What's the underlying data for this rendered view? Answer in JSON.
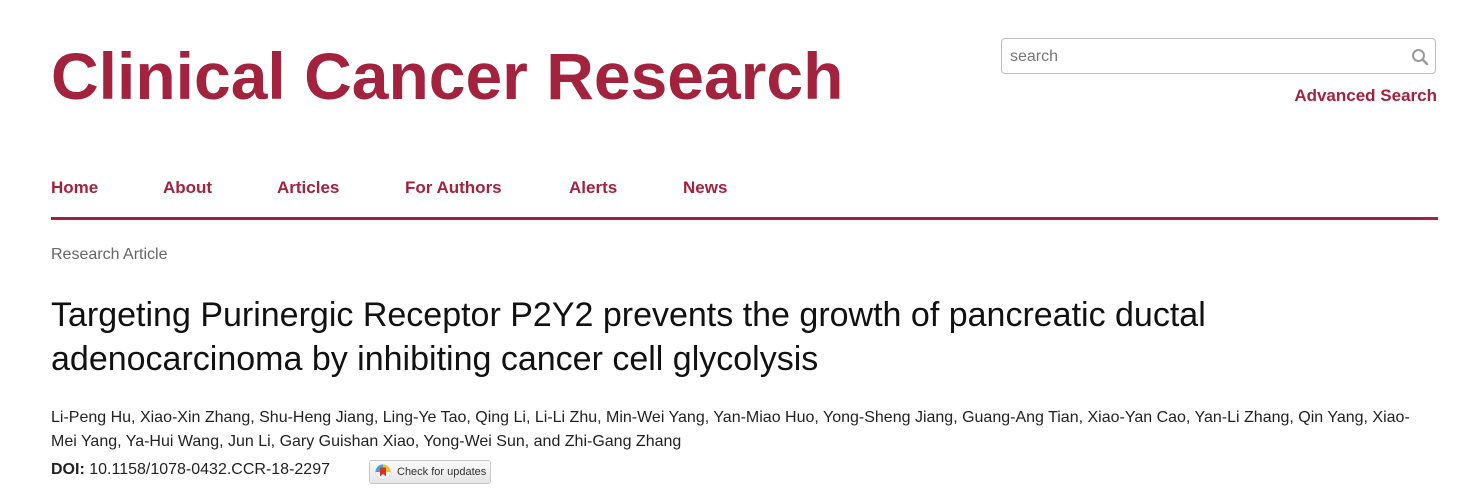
{
  "header": {
    "journal_title": "Clinical Cancer Research",
    "search": {
      "placeholder": "search",
      "value": ""
    },
    "advanced_search_label": "Advanced Search"
  },
  "nav": {
    "items": [
      {
        "label": "Home"
      },
      {
        "label": "About"
      },
      {
        "label": "Articles"
      },
      {
        "label": "For Authors"
      },
      {
        "label": "Alerts"
      },
      {
        "label": "News"
      }
    ]
  },
  "article": {
    "type": "Research Article",
    "title": "Targeting Purinergic Receptor P2Y2 prevents the growth of pancreatic ductal adenocarcinoma by inhibiting cancer cell glycolysis",
    "authors": "Li-Peng Hu, Xiao-Xin Zhang, Shu-Heng Jiang, Ling-Ye Tao, Qing Li, Li-Li Zhu, Min-Wei Yang, Yan-Miao Huo, Yong-Sheng Jiang, Guang-Ang Tian, Xiao-Yan Cao, Yan-Li Zhang, Qin Yang, Xiao-Mei Yang, Ya-Hui Wang, Jun Li, Gary Guishan Xiao, Yong-Wei Sun, and Zhi-Gang Zhang",
    "doi_label": "DOI:",
    "doi": "10.1158/1078-0432.CCR-18-2297",
    "check_updates_label": "Check for updates"
  },
  "colors": {
    "brand": "#a3223e"
  },
  "icons": {
    "search": "search-icon",
    "updates": "crossmark-icon"
  }
}
